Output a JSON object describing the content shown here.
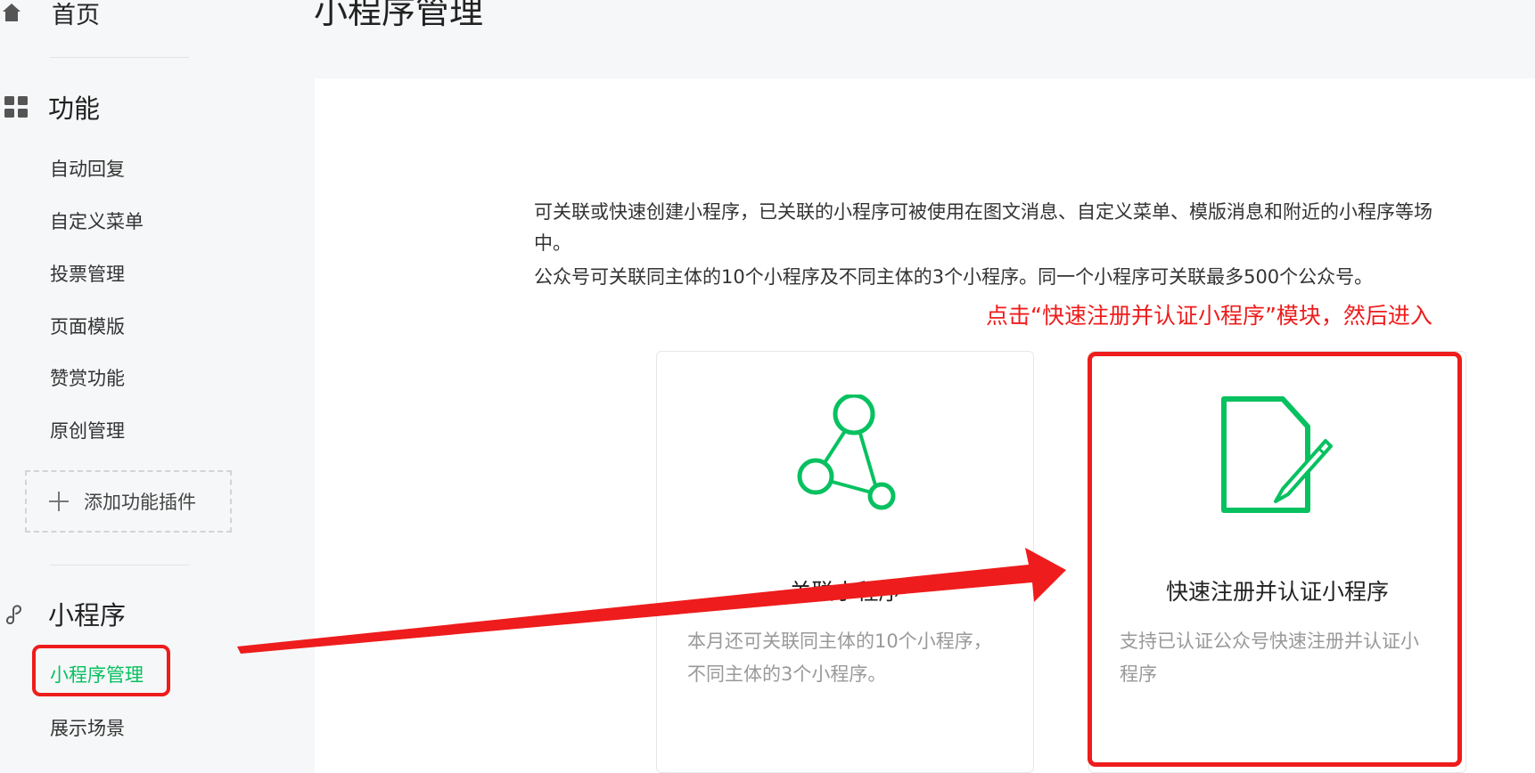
{
  "sidebar": {
    "home": {
      "label": "首页",
      "icon": "home-icon"
    },
    "function_section": {
      "label": "功能",
      "icon": "grid-icon"
    },
    "function_items": [
      {
        "label": "自动回复"
      },
      {
        "label": "自定义菜单"
      },
      {
        "label": "投票管理"
      },
      {
        "label": "页面模版"
      },
      {
        "label": "赞赏功能"
      },
      {
        "label": "原创管理"
      }
    ],
    "add_plugin": {
      "label": "添加功能插件",
      "icon": "plus-icon"
    },
    "miniprogram_section": {
      "label": "小程序",
      "icon": "miniprogram-icon"
    },
    "miniprogram_items": [
      {
        "label": "小程序管理",
        "active": true
      },
      {
        "label": "展示场景",
        "active": false
      }
    ]
  },
  "header": {
    "title": "小程序管理"
  },
  "main": {
    "description": {
      "line1": "可关联或快速创建小程序，已关联的小程序可被使用在图文消息、自定义菜单、模版消息和附近的小程序等场",
      "line2": "中。",
      "line3": "公众号可关联同主体的10个小程序及不同主体的3个小程序。同一个小程序可关联最多500个公众号。"
    },
    "annotation": "点击“快速注册并认证小程序”模块，然后进入",
    "cards": [
      {
        "title": "关联小程序",
        "description": "本月还可关联同主体的10个小程序，不同主体的3个小程序。",
        "icon": "link-nodes-icon"
      },
      {
        "title": "快速注册并认证小程序",
        "description": "支持已认证公众号快速注册并认证小程序",
        "icon": "document-edit-icon"
      }
    ]
  },
  "colors": {
    "accent_green": "#07c160",
    "annotation_red": "#ee1c1c",
    "background": "#f6f7f8",
    "panel": "#ffffff"
  }
}
